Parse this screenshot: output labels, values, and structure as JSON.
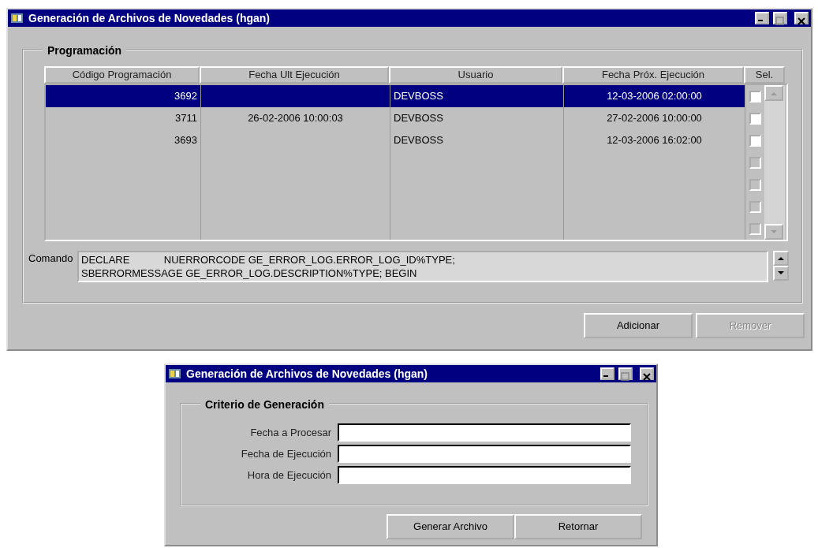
{
  "main_window": {
    "title": "Generación de Archivos de Novedades (hgan)",
    "group": {
      "title": "Programación"
    },
    "table": {
      "columns": [
        "Código Programación",
        "Fecha Ult Ejecución",
        "Usuario",
        "Fecha Próx. Ejecución",
        "Sel."
      ],
      "rows": [
        {
          "codigo": "3692",
          "usuario": "DEVBOSS",
          "fecha_prox": "12-03-2006 02:00:00",
          "selected": true,
          "checked": false,
          "disabled": false
        },
        {
          "codigo": "3711",
          "fecha_ult": "26-02-2006 10:00:03",
          "usuario": "DEVBOSS",
          "fecha_prox": "27-02-2006 10:00:00",
          "selected": false,
          "checked": false,
          "disabled": false
        },
        {
          "codigo": "3693",
          "usuario": "DEVBOSS",
          "fecha_prox": "12-03-2006 16:02:00",
          "selected": false,
          "checked": false,
          "disabled": false
        },
        {
          "selected": false,
          "checked": false,
          "disabled": true
        },
        {
          "selected": false,
          "checked": false,
          "disabled": true
        },
        {
          "selected": false,
          "checked": false,
          "disabled": true
        },
        {
          "selected": false,
          "checked": false,
          "disabled": true
        }
      ]
    },
    "command": {
      "label": "Comando",
      "lines": [
        "DECLARE            NUERRORCODE GE_ERROR_LOG.ERROR_LOG_ID%TYPE;",
        "SBERRORMESSAGE GE_ERROR_LOG.DESCRIPTION%TYPE; BEGIN"
      ]
    },
    "buttons": [
      {
        "label": "Adicionar",
        "disabled": false
      },
      {
        "label": "Remover",
        "disabled": true
      }
    ]
  },
  "dialog": {
    "title": "Generación de Archivos de Novedades (hgan)",
    "group": {
      "title": "Criterio de Generación"
    },
    "fields": [
      {
        "label": "Fecha a Procesar"
      },
      {
        "label": "Fecha de Ejecución"
      },
      {
        "label": "Hora de Ejecución"
      }
    ],
    "buttons": [
      {
        "label": "Generar Archivo",
        "disabled": false
      },
      {
        "label": "Retornar",
        "disabled": false
      }
    ]
  }
}
